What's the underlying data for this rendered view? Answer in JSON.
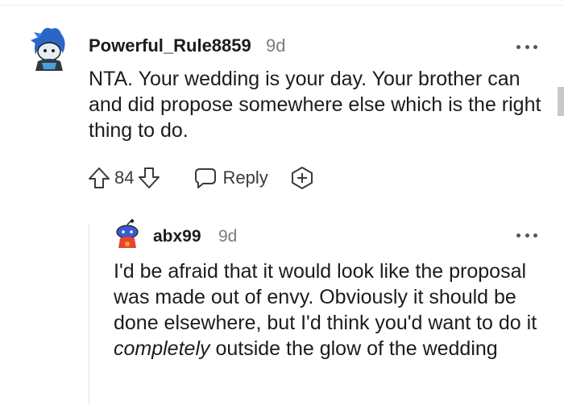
{
  "colors": {
    "text": "#1c1c1c",
    "meta": "#7c7c7c",
    "action": "#3a3a3a",
    "thread_line": "#e3e3e3"
  },
  "comment": {
    "author": "Powerful_Rule8859",
    "time": "9d",
    "avatar": "blue-haired-snoo-avatar",
    "body": "NTA. Your wedding is your day. Your brother can and did propose somewhere else which is the right thing to do.",
    "votes": "84",
    "reply_label": "Reply",
    "icons": [
      "upvote-icon",
      "downvote-icon",
      "reply-bubble-icon",
      "award-plus-icon",
      "more-options-icon"
    ]
  },
  "reply": {
    "author": "abx99",
    "time": "9d",
    "avatar": "snoo-avatar-red-orange",
    "body_before": "I'd be afraid that it would look like the proposal was made out of envy. Obviously it should be done elsewhere, but I'd think you'd want to do it ",
    "body_emphasis": "completely",
    "body_after": " outside the glow of the wedding"
  }
}
